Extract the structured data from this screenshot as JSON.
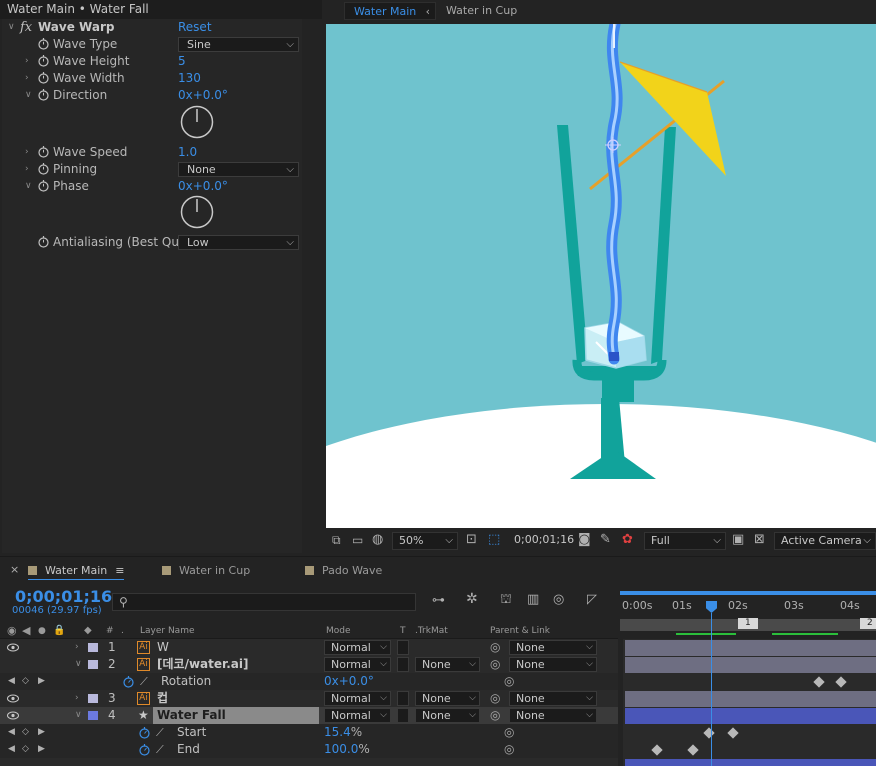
{
  "effect_panel": {
    "title": "Water Main • Water Fall",
    "effect_name": "Wave Warp",
    "reset_label": "Reset",
    "properties": [
      {
        "label": "Wave Type",
        "value": "Sine",
        "kind": "dropdown"
      },
      {
        "label": "Wave Height",
        "value": "5",
        "kind": "value"
      },
      {
        "label": "Wave Width",
        "value": "130",
        "kind": "value"
      },
      {
        "label": "Direction",
        "value_prefix": "0x",
        "value_suffix": "+0.0°",
        "kind": "angle"
      },
      {
        "label": "Wave Speed",
        "value": "1.0",
        "kind": "value"
      },
      {
        "label": "Pinning",
        "value": "None",
        "kind": "dropdown"
      },
      {
        "label": "Phase",
        "value_prefix": "0x",
        "value_suffix": "+0.0°",
        "kind": "angle"
      },
      {
        "label": "Antialiasing (Best Qu",
        "value": "Low",
        "kind": "dropdown"
      }
    ]
  },
  "viewer": {
    "tabs": [
      {
        "label": "Water Main",
        "active": true
      },
      {
        "label": "Water in Cup",
        "active": false
      }
    ],
    "zoom": "50%",
    "timecode": "0;00;01;16",
    "resolution": "Full",
    "camera": "Active Camera",
    "colors": {
      "background": "#6fc3ce",
      "ground": "#ffffff",
      "glass": "#11a39b",
      "umbrella": "#f2d31a",
      "stick": "#e6a02a",
      "water": "#3f86ef"
    }
  },
  "timeline": {
    "tabs": [
      {
        "label": "Water Main",
        "active": true
      },
      {
        "label": "Water in Cup",
        "active": false
      },
      {
        "label": "Pado Wave",
        "active": false
      }
    ],
    "menu_glyph": "≡",
    "current_time": "0;00;01;16",
    "frame_info": "00046 (29.97 fps)",
    "search_glyph": "⚲",
    "columns": {
      "num": "#",
      "dot": ".",
      "layer_name": "Layer Name",
      "mode": "Mode",
      "t": "T",
      "trkmat": ".TrkMat",
      "parent": "Parent & Link"
    },
    "ruler": [
      "0:00s",
      "01s",
      "02s",
      "03s",
      "04s"
    ],
    "markers": [
      "1",
      "2"
    ],
    "layers": [
      {
        "num": "1",
        "name": "W",
        "mode": "Normal",
        "trkmat": "",
        "parent": "None",
        "label_color": "#b9b9dc"
      },
      {
        "num": "2",
        "name": "[데코/water.ai]",
        "mode": "Normal",
        "trkmat": "None",
        "parent": "None",
        "label_color": "#b9b9dc"
      },
      {
        "num": "3",
        "name": "컵",
        "mode": "Normal",
        "trkmat": "None",
        "parent": "None",
        "label_color": "#b9b9dc"
      },
      {
        "num": "4",
        "name": "Water Fall",
        "mode": "Normal",
        "trkmat": "None",
        "parent": "None",
        "label_color": "#6c7ae0"
      }
    ],
    "properties": [
      {
        "name": "Rotation",
        "value_prefix": "0x",
        "value_suffix": "+0.0°"
      },
      {
        "name": "Start",
        "value": "15.4",
        "unit": "%"
      },
      {
        "name": "End",
        "value": "100.0",
        "unit": "%"
      }
    ]
  }
}
